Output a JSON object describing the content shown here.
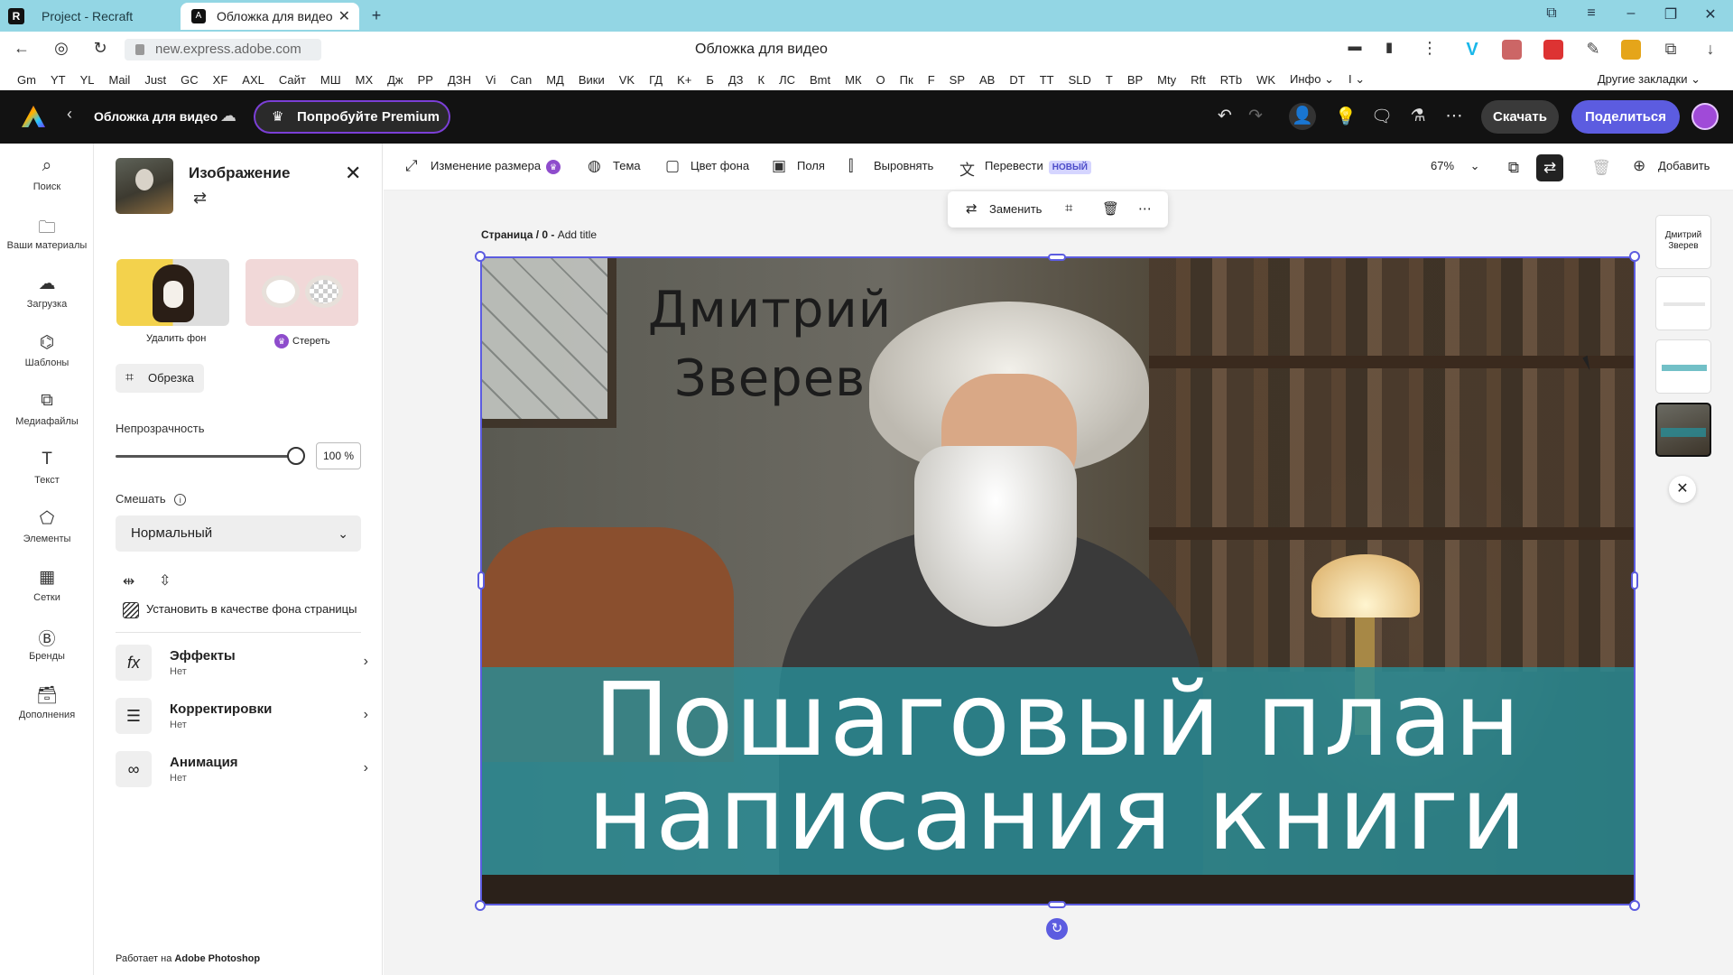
{
  "browser": {
    "tabs": [
      {
        "label": "Project - Recraft"
      },
      {
        "label": "Обложка для видео"
      }
    ],
    "url": "new.express.adobe.com",
    "page_title": "Обложка для видео",
    "bookmarks": [
      "Gm",
      "YT",
      "YL",
      "Mail",
      "Just",
      "GC",
      "XF",
      "AXL",
      "Сайт",
      "МШ",
      "MX",
      "Дж",
      "PP",
      "ДЗН",
      "Vi",
      "Can",
      "МД",
      "Вики",
      "VK",
      "ГД",
      "K+",
      "Б",
      "ДЗ",
      "К",
      "ЛС",
      "Bmt",
      "МК",
      "О",
      "Пк",
      "F",
      "SP",
      "AB",
      "DT",
      "TT",
      "SLD",
      "T",
      "BP",
      "Mty",
      "Rft",
      "RTb",
      "WK",
      "Инфо ⌄",
      "I ⌄"
    ],
    "other_bookmarks": "Другие закладки ⌄"
  },
  "header": {
    "doc_title": "Обложка для видео",
    "premium_label": "Попробуйте Premium",
    "download_label": "Скачать",
    "share_label": "Поделиться"
  },
  "rail": [
    {
      "label": "Поиск",
      "icon": "search-icon"
    },
    {
      "label": "Ваши материалы",
      "icon": "folder-icon"
    },
    {
      "label": "Загрузка",
      "icon": "upload-icon"
    },
    {
      "label": "Шаблоны",
      "icon": "templates-icon"
    },
    {
      "label": "Медиафайлы",
      "icon": "media-icon"
    },
    {
      "label": "Текст",
      "icon": "text-icon"
    },
    {
      "label": "Элементы",
      "icon": "shapes-icon"
    },
    {
      "label": "Сетки",
      "icon": "grid-icon"
    },
    {
      "label": "Бренды",
      "icon": "brand-icon"
    },
    {
      "label": "Дополнения",
      "icon": "addons-icon"
    }
  ],
  "panel": {
    "title": "Изображение",
    "remove_bg_label": "Удалить фон",
    "erase_label": "Стереть",
    "crop_label": "Обрезка",
    "opacity_label": "Непрозрачность",
    "opacity_value": "100 %",
    "opacity_fraction": 1.0,
    "blend_label": "Смешать",
    "blend_value": "Нормальный",
    "set_bg_label": "Установить в качестве фона страницы",
    "sections": [
      {
        "title": "Эффекты",
        "sub": "Нет",
        "icon": "fx-icon"
      },
      {
        "title": "Корректировки",
        "sub": "Нет",
        "icon": "sliders-icon"
      },
      {
        "title": "Анимация",
        "sub": "Нет",
        "icon": "animation-icon"
      }
    ],
    "powered_prefix": "Работает на ",
    "powered_brand": "Adobe Photoshop"
  },
  "toolbar": {
    "resize_label": "Изменение размера",
    "theme_label": "Тема",
    "bg_color_label": "Цвет фона",
    "margins_label": "Поля",
    "align_label": "Выровнять",
    "translate_label": "Перевести",
    "new_badge": "НОВЫЙ",
    "zoom": "67%",
    "add_label": "Добавить"
  },
  "floatbar": {
    "replace_label": "Заменить"
  },
  "canvas": {
    "page_prefix": "Страница / 0 - ",
    "page_title_placeholder": "Add title",
    "author_line1": "Дмитрий",
    "author_line2": "Зверев",
    "headline_line1": "Пошаговый план",
    "headline_line2": "написания книги"
  },
  "pages": {
    "thumb1_line1": "Дмитрий",
    "thumb1_line2": "Зверев"
  }
}
